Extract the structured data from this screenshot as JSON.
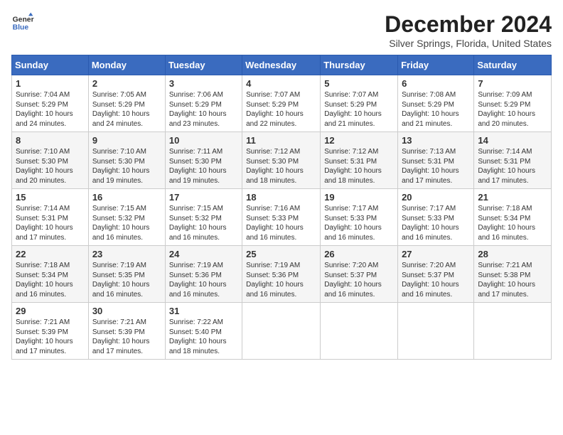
{
  "header": {
    "logo_line1": "General",
    "logo_line2": "Blue",
    "title": "December 2024",
    "subtitle": "Silver Springs, Florida, United States"
  },
  "days_of_week": [
    "Sunday",
    "Monday",
    "Tuesday",
    "Wednesday",
    "Thursday",
    "Friday",
    "Saturday"
  ],
  "weeks": [
    [
      {
        "day": "1",
        "sunrise": "7:04 AM",
        "sunset": "5:29 PM",
        "daylight": "10 hours and 24 minutes."
      },
      {
        "day": "2",
        "sunrise": "7:05 AM",
        "sunset": "5:29 PM",
        "daylight": "10 hours and 24 minutes."
      },
      {
        "day": "3",
        "sunrise": "7:06 AM",
        "sunset": "5:29 PM",
        "daylight": "10 hours and 23 minutes."
      },
      {
        "day": "4",
        "sunrise": "7:07 AM",
        "sunset": "5:29 PM",
        "daylight": "10 hours and 22 minutes."
      },
      {
        "day": "5",
        "sunrise": "7:07 AM",
        "sunset": "5:29 PM",
        "daylight": "10 hours and 21 minutes."
      },
      {
        "day": "6",
        "sunrise": "7:08 AM",
        "sunset": "5:29 PM",
        "daylight": "10 hours and 21 minutes."
      },
      {
        "day": "7",
        "sunrise": "7:09 AM",
        "sunset": "5:29 PM",
        "daylight": "10 hours and 20 minutes."
      }
    ],
    [
      {
        "day": "8",
        "sunrise": "7:10 AM",
        "sunset": "5:30 PM",
        "daylight": "10 hours and 20 minutes."
      },
      {
        "day": "9",
        "sunrise": "7:10 AM",
        "sunset": "5:30 PM",
        "daylight": "10 hours and 19 minutes."
      },
      {
        "day": "10",
        "sunrise": "7:11 AM",
        "sunset": "5:30 PM",
        "daylight": "10 hours and 19 minutes."
      },
      {
        "day": "11",
        "sunrise": "7:12 AM",
        "sunset": "5:30 PM",
        "daylight": "10 hours and 18 minutes."
      },
      {
        "day": "12",
        "sunrise": "7:12 AM",
        "sunset": "5:31 PM",
        "daylight": "10 hours and 18 minutes."
      },
      {
        "day": "13",
        "sunrise": "7:13 AM",
        "sunset": "5:31 PM",
        "daylight": "10 hours and 17 minutes."
      },
      {
        "day": "14",
        "sunrise": "7:14 AM",
        "sunset": "5:31 PM",
        "daylight": "10 hours and 17 minutes."
      }
    ],
    [
      {
        "day": "15",
        "sunrise": "7:14 AM",
        "sunset": "5:31 PM",
        "daylight": "10 hours and 17 minutes."
      },
      {
        "day": "16",
        "sunrise": "7:15 AM",
        "sunset": "5:32 PM",
        "daylight": "10 hours and 16 minutes."
      },
      {
        "day": "17",
        "sunrise": "7:15 AM",
        "sunset": "5:32 PM",
        "daylight": "10 hours and 16 minutes."
      },
      {
        "day": "18",
        "sunrise": "7:16 AM",
        "sunset": "5:33 PM",
        "daylight": "10 hours and 16 minutes."
      },
      {
        "day": "19",
        "sunrise": "7:17 AM",
        "sunset": "5:33 PM",
        "daylight": "10 hours and 16 minutes."
      },
      {
        "day": "20",
        "sunrise": "7:17 AM",
        "sunset": "5:33 PM",
        "daylight": "10 hours and 16 minutes."
      },
      {
        "day": "21",
        "sunrise": "7:18 AM",
        "sunset": "5:34 PM",
        "daylight": "10 hours and 16 minutes."
      }
    ],
    [
      {
        "day": "22",
        "sunrise": "7:18 AM",
        "sunset": "5:34 PM",
        "daylight": "10 hours and 16 minutes."
      },
      {
        "day": "23",
        "sunrise": "7:19 AM",
        "sunset": "5:35 PM",
        "daylight": "10 hours and 16 minutes."
      },
      {
        "day": "24",
        "sunrise": "7:19 AM",
        "sunset": "5:36 PM",
        "daylight": "10 hours and 16 minutes."
      },
      {
        "day": "25",
        "sunrise": "7:19 AM",
        "sunset": "5:36 PM",
        "daylight": "10 hours and 16 minutes."
      },
      {
        "day": "26",
        "sunrise": "7:20 AM",
        "sunset": "5:37 PM",
        "daylight": "10 hours and 16 minutes."
      },
      {
        "day": "27",
        "sunrise": "7:20 AM",
        "sunset": "5:37 PM",
        "daylight": "10 hours and 16 minutes."
      },
      {
        "day": "28",
        "sunrise": "7:21 AM",
        "sunset": "5:38 PM",
        "daylight": "10 hours and 17 minutes."
      }
    ],
    [
      {
        "day": "29",
        "sunrise": "7:21 AM",
        "sunset": "5:39 PM",
        "daylight": "10 hours and 17 minutes."
      },
      {
        "day": "30",
        "sunrise": "7:21 AM",
        "sunset": "5:39 PM",
        "daylight": "10 hours and 17 minutes."
      },
      {
        "day": "31",
        "sunrise": "7:22 AM",
        "sunset": "5:40 PM",
        "daylight": "10 hours and 18 minutes."
      },
      {
        "day": "",
        "sunrise": "",
        "sunset": "",
        "daylight": ""
      },
      {
        "day": "",
        "sunrise": "",
        "sunset": "",
        "daylight": ""
      },
      {
        "day": "",
        "sunrise": "",
        "sunset": "",
        "daylight": ""
      },
      {
        "day": "",
        "sunrise": "",
        "sunset": "",
        "daylight": ""
      }
    ]
  ],
  "labels": {
    "sunrise": "Sunrise:",
    "sunset": "Sunset:",
    "daylight": "Daylight:"
  }
}
